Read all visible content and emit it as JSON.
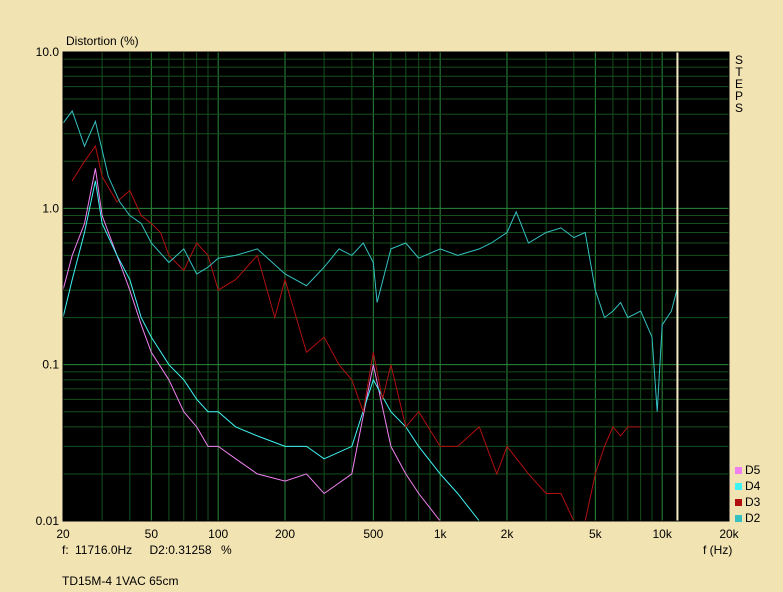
{
  "chart_data": {
    "type": "line",
    "ylabel": "Distortion (%)",
    "xlabel": "f (Hz)",
    "caption": "TD15M-4 1VAC 65cm",
    "side_label": "STEPS",
    "x_scale": "log",
    "y_scale": "log",
    "xlim": [
      20,
      20000
    ],
    "ylim": [
      0.01,
      10
    ],
    "x_ticks": [
      {
        "value": 20,
        "label": "20"
      },
      {
        "value": 50,
        "label": "50"
      },
      {
        "value": 100,
        "label": "100"
      },
      {
        "value": 200,
        "label": "200"
      },
      {
        "value": 500,
        "label": "500"
      },
      {
        "value": 1000,
        "label": "1k"
      },
      {
        "value": 2000,
        "label": "2k"
      },
      {
        "value": 5000,
        "label": "5k"
      },
      {
        "value": 10000,
        "label": "10k"
      },
      {
        "value": 20000,
        "label": "20k"
      }
    ],
    "y_ticks": [
      {
        "value": 10,
        "label": "10.0"
      },
      {
        "value": 1,
        "label": "1.0"
      },
      {
        "value": 0.1,
        "label": "0.1"
      },
      {
        "value": 0.01,
        "label": "0.01"
      }
    ],
    "grid": true,
    "legend_position": "bottom-right",
    "cursor": {
      "freq_label": "f:",
      "freq_value": "11716.0Hz",
      "series_label": "D2:",
      "series_value": "0.31258",
      "unit": "%",
      "x": 11716
    },
    "series": [
      {
        "name": "D2",
        "color": "#35c1c1",
        "x": [
          20,
          22,
          25,
          28,
          32,
          36,
          40,
          45,
          50,
          60,
          70,
          80,
          90,
          100,
          120,
          150,
          200,
          250,
          300,
          350,
          400,
          450,
          500,
          520,
          600,
          700,
          800,
          1000,
          1200,
          1500,
          1700,
          2000,
          2200,
          2500,
          3000,
          3500,
          4000,
          4500,
          5000,
          5500,
          6000,
          6500,
          7000,
          8000,
          9000,
          9500,
          10000,
          11000,
          11716
        ],
        "y": [
          3.5,
          4.2,
          2.5,
          3.6,
          1.6,
          1.1,
          0.9,
          0.8,
          0.6,
          0.45,
          0.55,
          0.38,
          0.42,
          0.48,
          0.5,
          0.55,
          0.38,
          0.32,
          0.42,
          0.55,
          0.5,
          0.6,
          0.45,
          0.25,
          0.55,
          0.6,
          0.48,
          0.55,
          0.5,
          0.55,
          0.6,
          0.7,
          0.95,
          0.6,
          0.7,
          0.75,
          0.65,
          0.7,
          0.3,
          0.2,
          0.22,
          0.25,
          0.2,
          0.22,
          0.15,
          0.05,
          0.18,
          0.22,
          0.31
        ]
      },
      {
        "name": "D3",
        "color": "#b01010",
        "x": [
          22,
          25,
          28,
          30,
          35,
          40,
          45,
          50,
          55,
          60,
          70,
          80,
          90,
          100,
          120,
          150,
          180,
          200,
          250,
          300,
          350,
          400,
          450,
          500,
          550,
          600,
          700,
          800,
          1000,
          1200,
          1500,
          1800,
          2000,
          2500,
          3000,
          3500,
          4000,
          4500,
          5000,
          5500,
          6000,
          6500,
          7000,
          8000
        ],
        "y": [
          1.5,
          2.0,
          2.5,
          1.6,
          1.1,
          1.3,
          0.9,
          0.8,
          0.7,
          0.5,
          0.4,
          0.6,
          0.5,
          0.3,
          0.35,
          0.5,
          0.2,
          0.35,
          0.12,
          0.15,
          0.1,
          0.08,
          0.05,
          0.12,
          0.06,
          0.1,
          0.04,
          0.05,
          0.03,
          0.03,
          0.04,
          0.02,
          0.03,
          0.02,
          0.015,
          0.015,
          0.01,
          0.01,
          0.02,
          0.03,
          0.04,
          0.035,
          0.04,
          0.04
        ]
      },
      {
        "name": "D4",
        "color": "#3ff3f3",
        "x": [
          20,
          22,
          25,
          28,
          30,
          35,
          40,
          45,
          50,
          60,
          70,
          80,
          90,
          100,
          120,
          150,
          200,
          250,
          300,
          400,
          500,
          600,
          700,
          800,
          1000,
          1200,
          1500
        ],
        "y": [
          0.2,
          0.35,
          0.7,
          1.5,
          0.8,
          0.5,
          0.35,
          0.2,
          0.15,
          0.1,
          0.08,
          0.06,
          0.05,
          0.05,
          0.04,
          0.035,
          0.03,
          0.03,
          0.025,
          0.03,
          0.08,
          0.05,
          0.04,
          0.03,
          0.02,
          0.015,
          0.01
        ]
      },
      {
        "name": "D5",
        "color": "#f080f0",
        "x": [
          20,
          22,
          25,
          28,
          30,
          35,
          40,
          45,
          50,
          60,
          70,
          80,
          90,
          100,
          120,
          150,
          200,
          250,
          300,
          400,
          500,
          600,
          700,
          800,
          1000
        ],
        "y": [
          0.3,
          0.5,
          0.8,
          1.8,
          0.9,
          0.5,
          0.3,
          0.18,
          0.12,
          0.08,
          0.05,
          0.04,
          0.03,
          0.03,
          0.025,
          0.02,
          0.018,
          0.02,
          0.015,
          0.02,
          0.1,
          0.03,
          0.02,
          0.015,
          0.01
        ]
      }
    ]
  }
}
